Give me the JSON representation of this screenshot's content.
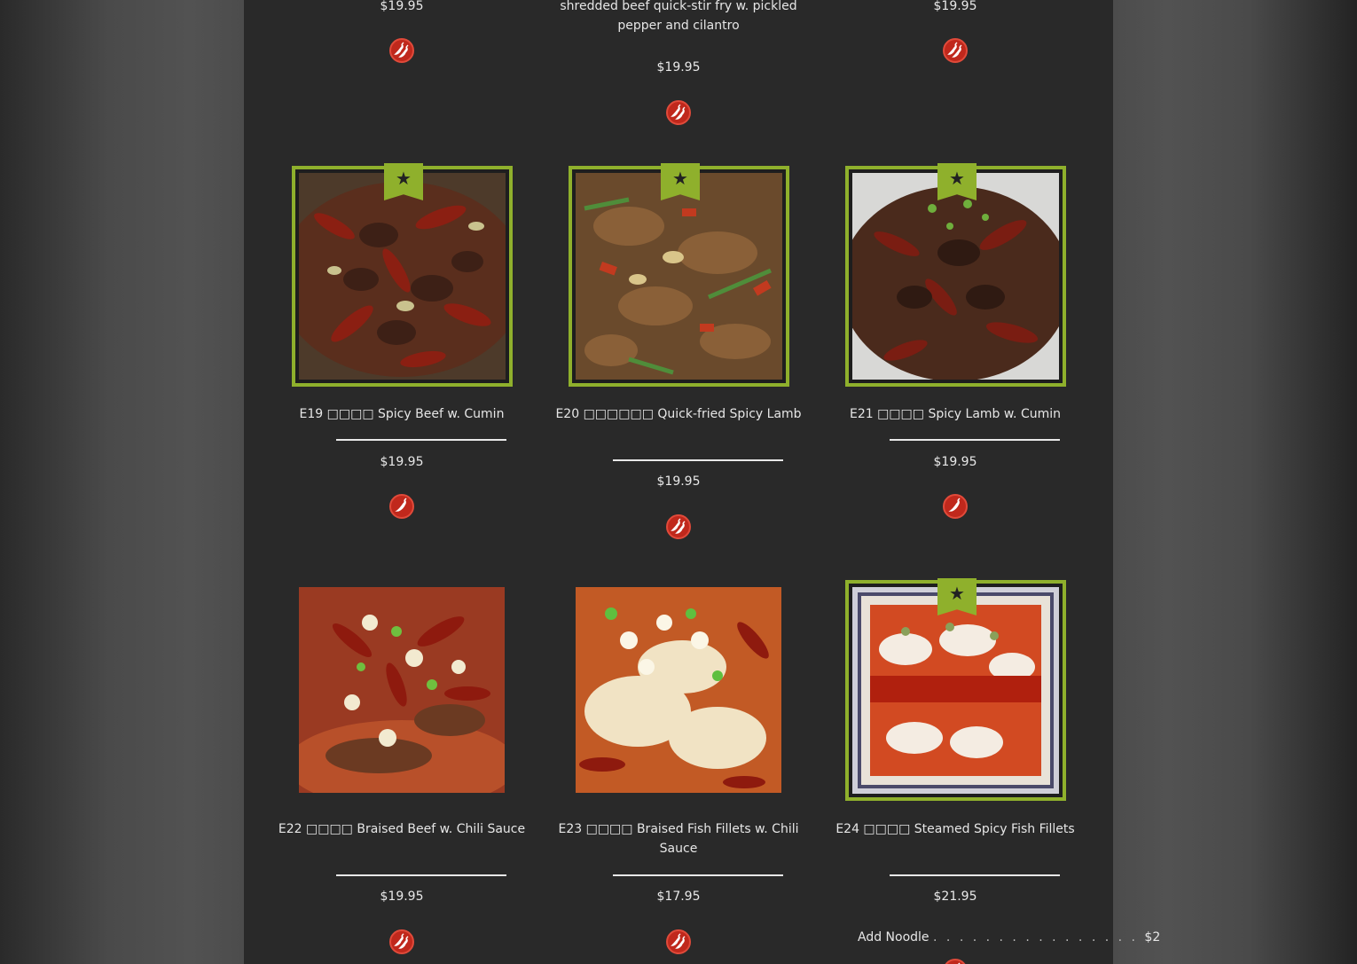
{
  "top_row": {
    "left_price": "$19.95",
    "middle_desc": "shredded beef quick-stir fry w. pickled pepper and cilantro",
    "middle_price": "$19.95",
    "right_price": "$19.95"
  },
  "items": [
    {
      "name": "E19 □□□□ Spicy Beef w. Cumin",
      "price": "$19.95",
      "featured": true,
      "spice": "single"
    },
    {
      "name": "E20 □□□□□□ Quick-fried Spicy Lamb",
      "price": "$19.95",
      "featured": true,
      "spice": "double"
    },
    {
      "name": "E21 □□□□ Spicy Lamb w. Cumin",
      "price": "$19.95",
      "featured": true,
      "spice": "single"
    },
    {
      "name": "E22 □□□□ Braised Beef w. Chili Sauce",
      "price": "$19.95",
      "featured": false,
      "spice": "double"
    },
    {
      "name": "E23 □□□□ Braised Fish Fillets w. Chili Sauce",
      "price": "$17.95",
      "featured": false,
      "spice": "double"
    },
    {
      "name": "E24 □□□□ Steamed Spicy Fish Fillets",
      "price": "$21.95",
      "featured": true,
      "spice": "double"
    }
  ],
  "addon": {
    "label": "Add Noodle",
    "price": "$2"
  },
  "colors": {
    "frame": "#8fb02c",
    "chili_badge": "#c0281c",
    "panel": "#292929"
  },
  "icons": {
    "featured": "star-icon",
    "spicy": "chili-pepper-icon"
  }
}
